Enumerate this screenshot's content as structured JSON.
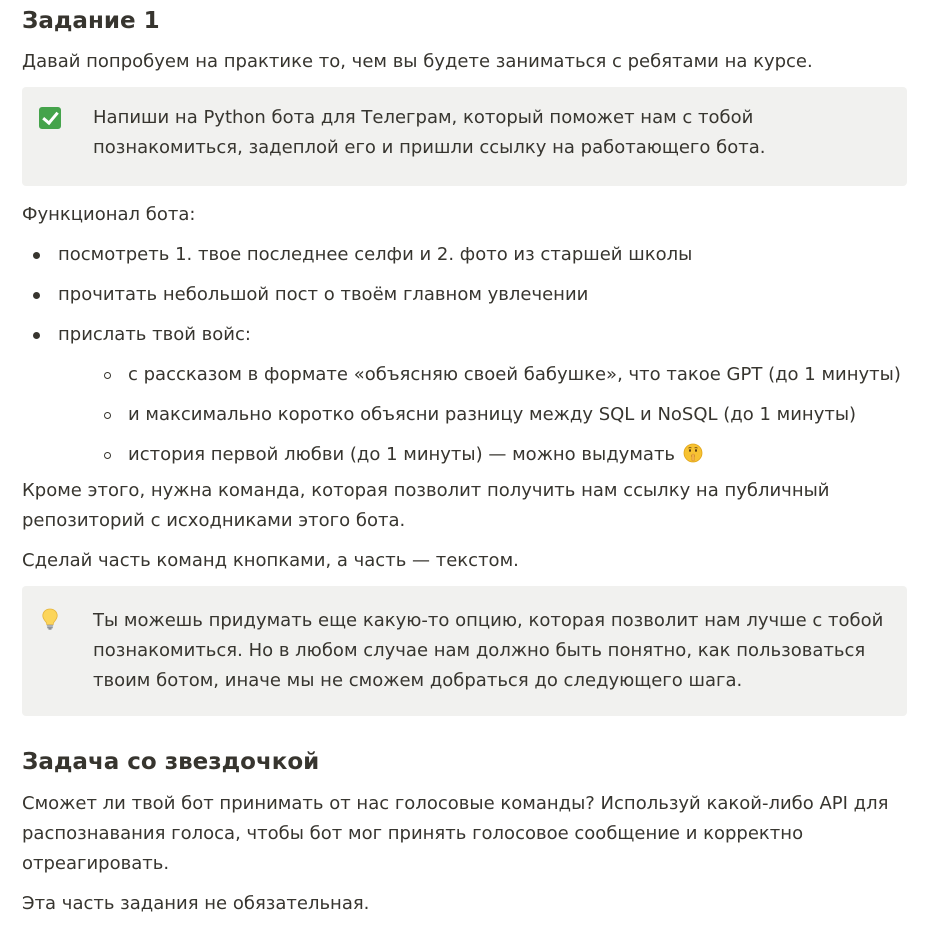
{
  "task": {
    "title": "Задание 1",
    "intro": "Давай попробуем на практике то, чем вы будете заниматься с ребятами на курсе.",
    "callout_main": {
      "icon": "check-mark-icon",
      "icon_color": "#45a34b",
      "text": "Напиши на Python бота для Телеграм, который поможет нам с тобой познакомиться, задеплой его и пришли ссылку на работающего бота."
    },
    "features_title": "Функционал бота:",
    "features": [
      "посмотреть 1. твое последнее селфи и 2. фото из старшей школы",
      "прочитать небольшой пост о твоём главном увлечении",
      "прислать твой войс:"
    ],
    "voice_items": [
      "с рассказом в формате «объясняю своей бабушке», что такое GPT (до 1 минуты)",
      "и максимально коротко объясни разницу между SQL и NoSQL (до 1 минуты)",
      "история первой любви (до 1 минуты) — можно выдумать"
    ],
    "voice_last_emoji": "shushing-face-icon",
    "extra_command": "Кроме этого, нужна команда, которая позволит получить нам ссылку на публичный репозиторий с исходниками этого бота.",
    "buttons_note": "Сделай часть команд кнопками, а часть — текстом.",
    "callout_tip": {
      "icon": "light-bulb-icon",
      "text": "Ты можешь придумать еще какую-то опцию, которая позволит нам лучше с тобой познакомиться. Но в любом случае нам должно быть понятно, как пользоваться твоим ботом, иначе мы не сможем добраться до следующего шага."
    }
  },
  "star_task": {
    "title": "Задача со звездочкой",
    "text": "Сможет ли твой бот принимать от нас голосовые команды? Используй какой-либо API для распознавания голоса, чтобы бот мог принять голосовое сообщение и корректно отреагировать.",
    "optional": "Эта часть задания не обязательная."
  },
  "colors": {
    "text": "#37352f",
    "callout_bg": "#f1f1ef"
  }
}
